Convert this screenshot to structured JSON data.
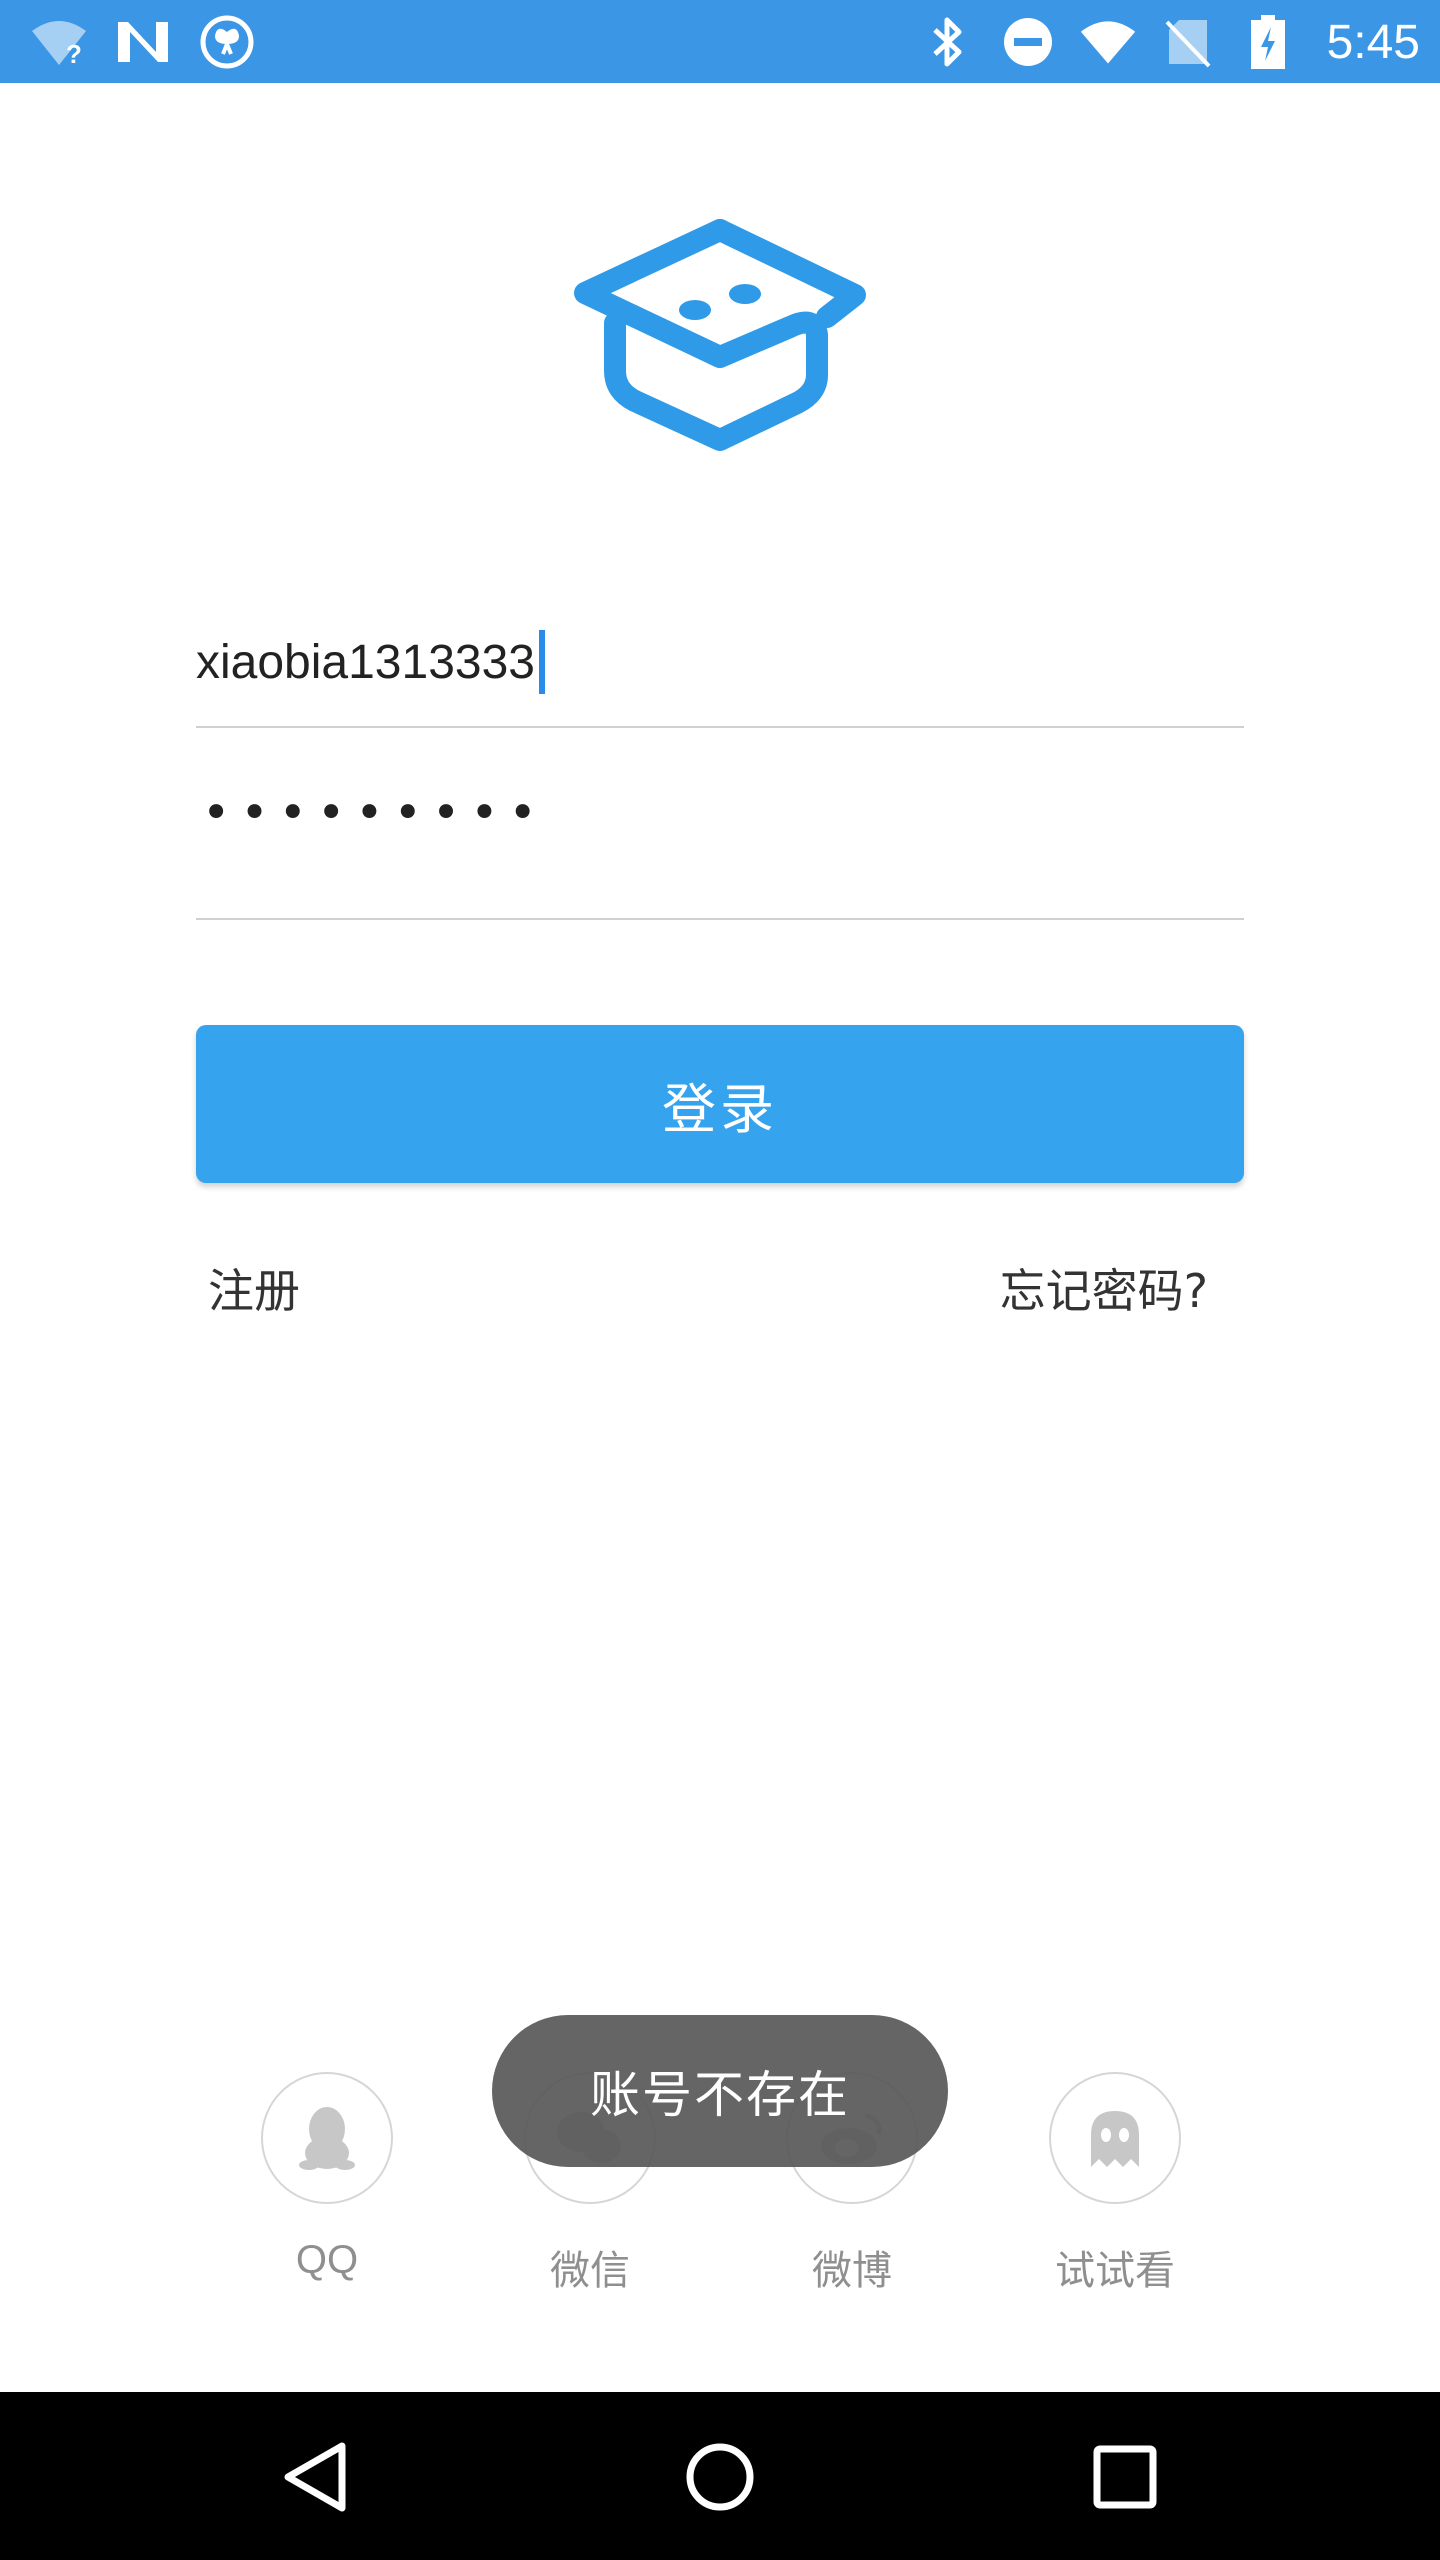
{
  "status_bar": {
    "time": "5:45",
    "left_icons": [
      "wifi-unknown-icon",
      "n-notification-icon",
      "butterfly-app-icon"
    ],
    "right_icons": [
      "bluetooth-icon",
      "do-not-disturb-icon",
      "wifi-icon",
      "no-sim-icon",
      "battery-charging-icon"
    ]
  },
  "login": {
    "username_value": "xiaobia1313333",
    "password_masked": "•••••••••",
    "login_button": "登录",
    "register_link": "注册",
    "forgot_link": "忘记密码?"
  },
  "social": [
    {
      "label": "QQ",
      "icon": "qq-penguin-icon"
    },
    {
      "label": "微信",
      "icon": "wechat-icon"
    },
    {
      "label": "微博",
      "icon": "weibo-icon"
    },
    {
      "label": "试试看",
      "icon": "ghost-icon"
    }
  ],
  "toast": {
    "message": "账号不存在"
  },
  "nav_bar": {
    "icons": [
      "back-icon",
      "home-icon",
      "recents-icon"
    ]
  },
  "colors": {
    "accent": "#36a3ef",
    "status_bar": "#3b96e6",
    "logo": "#2f9be8"
  }
}
